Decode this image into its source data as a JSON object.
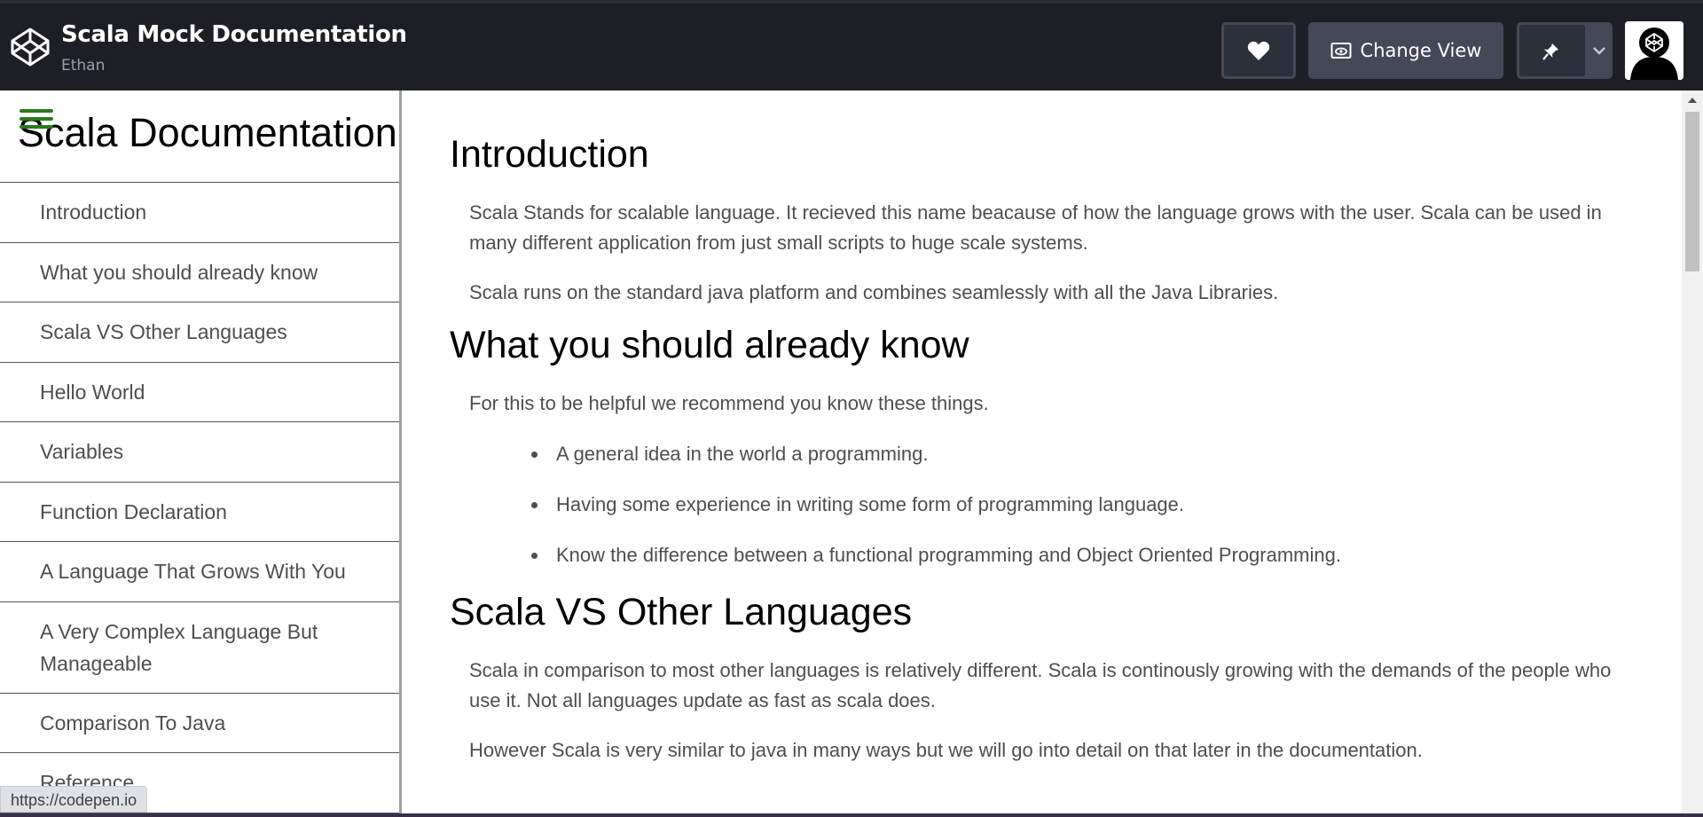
{
  "header": {
    "pen_title": "Scala Mock Documentation",
    "author": "Ethan",
    "change_view_label": "Change View"
  },
  "nav": {
    "title": "Scala Documentation",
    "links": [
      "Introduction",
      "What you should already know",
      "Scala VS Other Languages",
      "Hello World",
      "Variables",
      "Function Declaration",
      "A Language That Grows With You",
      "A Very Complex Language But Manageable",
      "Comparison To Java",
      "Reference"
    ]
  },
  "main": {
    "sections": [
      {
        "title": "Introduction",
        "paragraphs": [
          "Scala Stands for scalable language. It recieved this name beacause of how the language grows with the user. Scala can be used in many different application from just small scripts to huge scale systems.",
          "Scala runs on the standard java platform and combines seamlessly with all the Java Libraries."
        ]
      },
      {
        "title": "What you should already know",
        "intro": "For this to be helpful we recommend you know these things.",
        "bullets": [
          "A general idea in the world a programming.",
          "Having some experience in writing some form of programming language.",
          "Know the difference between a functional programming and Object Oriented Programming."
        ]
      },
      {
        "title": "Scala VS Other Languages",
        "paragraphs": [
          "Scala in comparison to most other languages is relatively different. Scala is continously growing with the demands of the people who use it. Not all languages update as fast as scala does.",
          "However Scala is very similar to java in many ways but we will go into detail on that later in the documentation."
        ]
      }
    ]
  },
  "status_bar": {
    "url": "https://codepen.io"
  },
  "icons": {
    "logo": "codepen-logo-icon",
    "heart": "heart-icon",
    "view": "eye-icon",
    "pin": "pin-icon",
    "chevron": "chevron-down-icon",
    "menu": "hamburger-menu-icon"
  },
  "colors": {
    "header_bg": "#1e1f26",
    "button_bg": "#444857",
    "hamburger": "#2a7a1a",
    "nav_text": "#4d4e53"
  }
}
